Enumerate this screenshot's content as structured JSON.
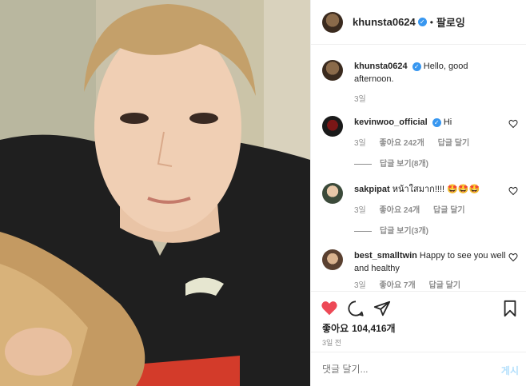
{
  "post": {
    "username": "khunsta0624",
    "verified_mark": "✓",
    "dot": "•",
    "follow_label": "팔로잉",
    "caption": "Hello, good afternoon.",
    "caption_time": "3일",
    "photo_icon": "selfie-photo"
  },
  "comments": [
    {
      "user": "kevinwoo_official",
      "verified": true,
      "text": "Hi",
      "time": "3일",
      "likes": "좋아요 242개",
      "reply_label": "답글 달기",
      "view_replies": "답글 보기(8개)"
    },
    {
      "user": "sakpipat",
      "verified": false,
      "text": "หน้าใสมาก!!!! 🤩🤩🤩",
      "time": "3일",
      "likes": "좋아요 24개",
      "reply_label": "답글 달기",
      "view_replies": "답글 보기(3개)"
    },
    {
      "user": "best_smalltwin",
      "verified": false,
      "text": "Happy to see you well and healthy",
      "time": "3일",
      "likes": "좋아요 7개",
      "reply_label": "답글 달기"
    }
  ],
  "actions": {
    "like_icon": "heart-filled-icon",
    "comment_icon": "comment-icon",
    "share_icon": "share-icon",
    "save_icon": "bookmark-icon",
    "like_color": "#ed4956"
  },
  "likes": {
    "label": "좋아요",
    "count": "104,416개"
  },
  "posted_ago": "3일 전",
  "add_comment": {
    "placeholder": "댓글 달기...",
    "post_label": "게시"
  }
}
